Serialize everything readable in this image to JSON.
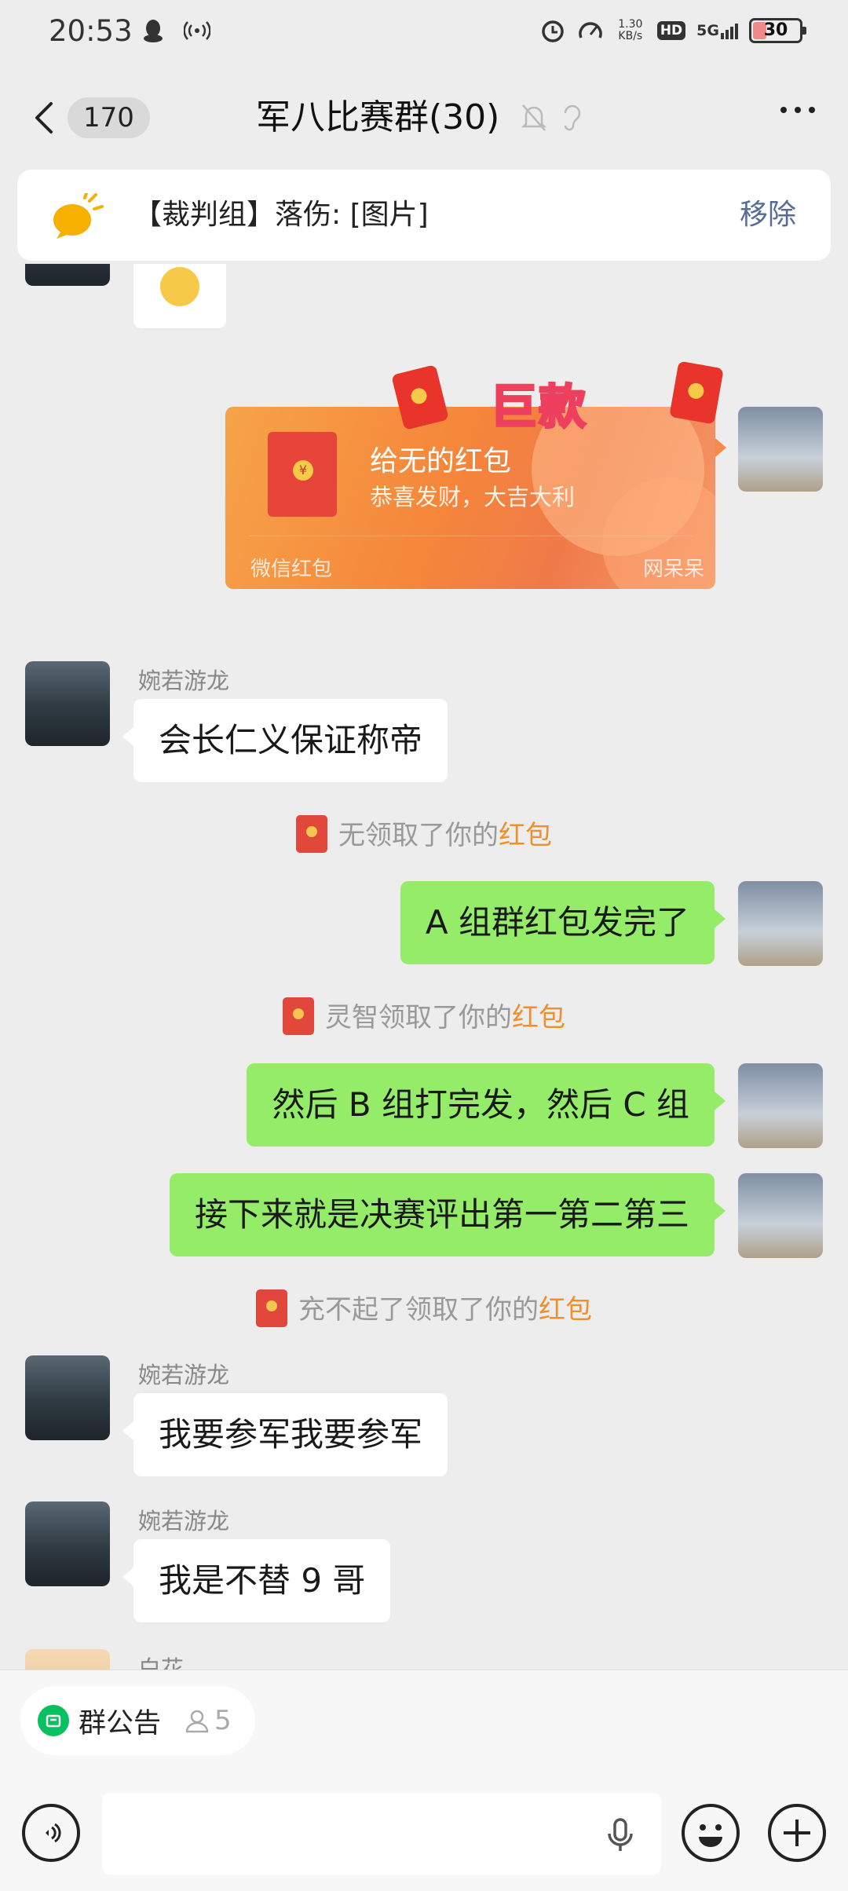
{
  "status_bar": {
    "time": "20:53",
    "speed_value": "1.30",
    "speed_unit": "KB/s",
    "hd": "HD",
    "network": "5G",
    "battery": "30",
    "battery_level": 0.3
  },
  "nav": {
    "unread_count": "170",
    "title": "军八比赛群(30)"
  },
  "pinned": {
    "text": "【裁判组】落伤: [图片]",
    "action": "移除"
  },
  "red_packet": {
    "title": "给无的红包",
    "greeting": "恭喜发财，大吉大利",
    "brand": "微信红包",
    "watermark": "网呆呆",
    "banner": "巨款",
    "coin_symbol": "¥"
  },
  "messages": [
    {
      "sender": "婉若游龙",
      "text": "会长仁义保证称帝"
    },
    {
      "text": "A 组群红包发完了"
    },
    {
      "text": "然后 B 组打完发，然后 C 组"
    },
    {
      "text": "接下来就是决赛评出第一第二第三"
    },
    {
      "sender": "婉若游龙",
      "text": "我要参军我要参军"
    },
    {
      "sender": "婉若游龙",
      "text": "我是不替 9 哥"
    },
    {
      "sender": "白花"
    }
  ],
  "system_notes": [
    {
      "prefix": "无领取了你的",
      "highlight": "红包"
    },
    {
      "prefix": "灵智领取了你的",
      "highlight": "红包"
    },
    {
      "prefix": "充不起了领取了你的",
      "highlight": "红包"
    }
  ],
  "bottom": {
    "announcement": "群公告",
    "announcement_count": "5",
    "input_value": "",
    "input_placeholder": ""
  },
  "colors": {
    "accent_green": "#07c160",
    "outgoing_bubble": "#95ec69",
    "link_blue": "#576b95",
    "packet_orange": "#f5863a",
    "highlight_orange": "#f08f2b"
  }
}
